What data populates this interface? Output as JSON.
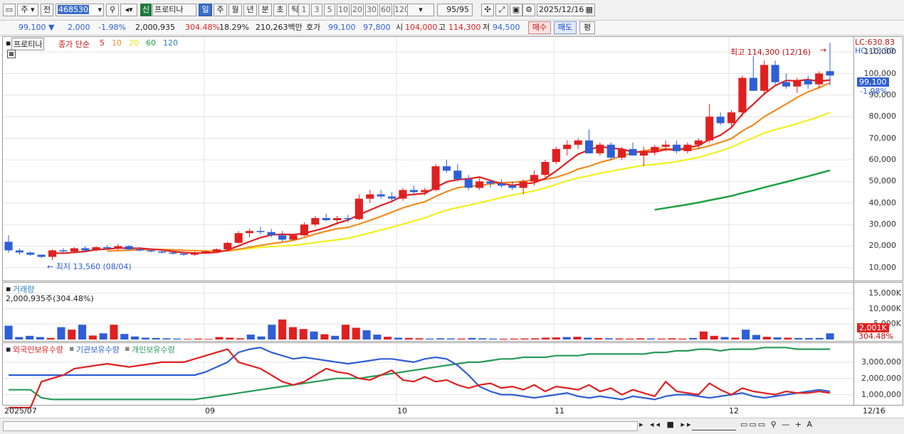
{
  "toolbar": {
    "market": "주",
    "prev": "전",
    "code": "468530",
    "sin": "신",
    "name": "프로티나",
    "periods": [
      "일",
      "주",
      "월",
      "년",
      "분",
      "초",
      "틱"
    ],
    "selected_period": "일",
    "minutes": [
      "1",
      "3",
      "5",
      "10",
      "20",
      "30",
      "60",
      "120"
    ],
    "count": "95",
    "count_total": "/95",
    "date": "2025/12/16"
  },
  "quote": {
    "price": "99,100",
    "arrow": "▼",
    "change": "2,000",
    "change_pct": "-1.98%",
    "volume": "2,000,935",
    "volume_ratio": "304.48%",
    "turnover": "18.29%",
    "amount": "210,263백만",
    "ask_label": "호가",
    "ask": "99,100",
    "bid": "97,800",
    "open_label": "시",
    "open": "104,000",
    "high_label": "고",
    "high": "114,300",
    "low_label": "저",
    "low": "94,500",
    "buy_label": "매수",
    "sell_label": "매도",
    "avg_label": "평"
  },
  "price_panel": {
    "name_tag": "프로티나",
    "ma_title": "종가 단순",
    "ma": [
      {
        "period": "5",
        "color": "#e02020"
      },
      {
        "period": "10",
        "color": "#f08c20"
      },
      {
        "period": "20",
        "color": "#e8e820"
      },
      {
        "period": "60",
        "color": "#20a040"
      },
      {
        "period": "120",
        "color": "#2a80c0"
      }
    ],
    "high_annotation": "최고 114,300 (12/16)",
    "low_annotation": "최저 13,560 (08/04)",
    "lc": "LC:630.83",
    "hc": "HC:-13.30",
    "last_price_tag": "99,100",
    "last_pct_tag": "-1.98%",
    "ticks": [
      "110,000",
      "100,000",
      "90,000",
      "80,000",
      "70,000",
      "60,000",
      "50,000",
      "40,000",
      "30,000",
      "20,000",
      "10,000"
    ]
  },
  "volume_panel": {
    "title": "거래량",
    "info": "2,000,935주(304.48%)",
    "ticks": [
      "15,000K",
      "10,000K",
      "5,000K"
    ],
    "last_tag": "2,001K",
    "last_pct": "304.48%"
  },
  "holding_panel": {
    "series": [
      {
        "name": "외국인보유수량",
        "color": "#e02020"
      },
      {
        "name": "기관보유수량",
        "color": "#2f5fd6"
      },
      {
        "name": "개인보유수량",
        "color": "#2a9a5a"
      }
    ],
    "ticks": [
      "3,000,000",
      "2,000,000",
      "1,000,000"
    ]
  },
  "xaxis": {
    "labels": [
      "2025/07",
      "09",
      "10",
      "11",
      "12"
    ],
    "last": "12/16"
  },
  "chart_data": {
    "type": "candlestick",
    "candles": [
      [
        22000,
        25000,
        17000,
        18000
      ],
      [
        18000,
        19000,
        16000,
        17000
      ],
      [
        17000,
        17500,
        15500,
        16000
      ],
      [
        16000,
        16000,
        14500,
        15000
      ],
      [
        15000,
        18500,
        13560,
        18000
      ],
      [
        18000,
        19000,
        16500,
        17500
      ],
      [
        17500,
        19500,
        17000,
        19000
      ],
      [
        19000,
        20000,
        17500,
        18000
      ],
      [
        18000,
        20000,
        17500,
        19500
      ],
      [
        19500,
        20500,
        18500,
        19000
      ],
      [
        19000,
        21000,
        18000,
        20000
      ],
      [
        20000,
        20500,
        18000,
        18500
      ],
      [
        18500,
        19500,
        17500,
        18000
      ],
      [
        18000,
        18500,
        17000,
        17500
      ],
      [
        17500,
        18000,
        16500,
        17000
      ],
      [
        17000,
        17500,
        16000,
        16500
      ],
      [
        16500,
        17000,
        15500,
        16000
      ],
      [
        16000,
        17500,
        15500,
        17000
      ],
      [
        17000,
        18000,
        16500,
        17500
      ],
      [
        17500,
        19000,
        17000,
        18500
      ],
      [
        18500,
        22000,
        18000,
        21500
      ],
      [
        21500,
        27000,
        21000,
        26000
      ],
      [
        26000,
        28000,
        24000,
        27000
      ],
      [
        27000,
        29000,
        25500,
        26500
      ],
      [
        26500,
        28000,
        24000,
        25000
      ],
      [
        25000,
        27000,
        22000,
        23000
      ],
      [
        23000,
        25500,
        22500,
        25000
      ],
      [
        25000,
        31000,
        24500,
        30000
      ],
      [
        30000,
        34000,
        29000,
        33000
      ],
      [
        33000,
        35000,
        31500,
        32000
      ],
      [
        32000,
        34000,
        30000,
        33000
      ],
      [
        33000,
        34500,
        31000,
        32500
      ],
      [
        32500,
        44000,
        32000,
        42000
      ],
      [
        42000,
        46000,
        40000,
        44000
      ],
      [
        44000,
        46000,
        42000,
        43000
      ],
      [
        43000,
        45000,
        40500,
        42000
      ],
      [
        42000,
        47000,
        41000,
        46000
      ],
      [
        46000,
        48000,
        44500,
        45000
      ],
      [
        45000,
        47000,
        43500,
        46000
      ],
      [
        46000,
        58000,
        45500,
        57000
      ],
      [
        57000,
        60000,
        54000,
        55000
      ],
      [
        55000,
        58000,
        50000,
        51000
      ],
      [
        51000,
        53000,
        46000,
        47000
      ],
      [
        47000,
        52000,
        46000,
        50000
      ],
      [
        50000,
        51000,
        47000,
        49000
      ],
      [
        49000,
        51000,
        47000,
        48000
      ],
      [
        48000,
        50000,
        46000,
        47000
      ],
      [
        47000,
        51000,
        44000,
        50000
      ],
      [
        50000,
        55000,
        48000,
        53000
      ],
      [
        53000,
        60000,
        52000,
        59000
      ],
      [
        59000,
        66000,
        58000,
        65000
      ],
      [
        65000,
        69000,
        62000,
        67000
      ],
      [
        67000,
        70000,
        65000,
        69000
      ],
      [
        69000,
        74000,
        68000,
        63000
      ],
      [
        63000,
        68000,
        62000,
        67000
      ],
      [
        67000,
        68000,
        60000,
        61000
      ],
      [
        61000,
        66000,
        60000,
        65000
      ],
      [
        65000,
        68000,
        63000,
        62000
      ],
      [
        62000,
        66000,
        57000,
        64000
      ],
      [
        64000,
        67000,
        62000,
        66000
      ],
      [
        66000,
        69000,
        64000,
        67000
      ],
      [
        67000,
        69000,
        63000,
        64000
      ],
      [
        64000,
        68000,
        63000,
        67000
      ],
      [
        67000,
        70000,
        65000,
        69000
      ],
      [
        69000,
        86000,
        68000,
        80000
      ],
      [
        80000,
        82000,
        76000,
        77000
      ],
      [
        77000,
        83000,
        75000,
        82000
      ],
      [
        82000,
        99000,
        80000,
        98000
      ],
      [
        98000,
        108000,
        96000,
        92000
      ],
      [
        92000,
        106000,
        90000,
        104000
      ],
      [
        104000,
        106000,
        95000,
        96000
      ],
      [
        96000,
        100000,
        93000,
        94000
      ],
      [
        94000,
        98000,
        91000,
        97000
      ],
      [
        97000,
        99000,
        93000,
        95000
      ],
      [
        95000,
        101000,
        93000,
        100000
      ],
      [
        101100,
        114300,
        94500,
        99100
      ]
    ],
    "ylim": [
      5000,
      115000
    ],
    "volume_k": [
      4500,
      800,
      1200,
      800,
      500,
      4000,
      3200,
      4800,
      1300,
      2000,
      4800,
      1800,
      1000,
      600,
      500,
      400,
      300,
      200,
      300,
      200,
      800,
      600,
      400,
      1600,
      1000,
      4800,
      6500,
      4000,
      3400,
      2600,
      1700,
      1200,
      4800,
      3800,
      3000,
      1600,
      900,
      600,
      500,
      400,
      300,
      400,
      350,
      300,
      500,
      400,
      300,
      250,
      300,
      350,
      400,
      600,
      700,
      800,
      900,
      600,
      500,
      400,
      350,
      300,
      400,
      350,
      300,
      400,
      300,
      500,
      2600,
      1200,
      800,
      600,
      3200,
      1500,
      900,
      700,
      600,
      500,
      450,
      500,
      2001
    ],
    "vol_ylim": [
      0,
      17500
    ],
    "holdings": {
      "foreign": [
        200,
        200,
        200,
        1800,
        2000,
        2200,
        2600,
        2700,
        2800,
        2900,
        2800,
        2700,
        2800,
        2900,
        3000,
        3000,
        3000,
        3200,
        3400,
        3600,
        3800,
        3000,
        2800,
        2600,
        2200,
        1800,
        1600,
        1800,
        2200,
        2600,
        2400,
        2300,
        2000,
        1900,
        2200,
        2500,
        1900,
        1800,
        2100,
        1800,
        1900,
        1600,
        1400,
        1600,
        1700,
        1400,
        1500,
        1300,
        1600,
        1200,
        1500,
        1400,
        1300,
        1600,
        1200,
        1400,
        1000,
        1300,
        1100,
        900,
        1800,
        1200,
        1100,
        1000,
        1700,
        1300,
        1000,
        1400,
        1200,
        1100,
        1000,
        1200,
        1100,
        1100,
        1200,
        1100
      ],
      "institution": [
        2200,
        2200,
        2200,
        2200,
        2200,
        2200,
        2200,
        2200,
        2200,
        2200,
        2200,
        2200,
        2200,
        2200,
        2200,
        2200,
        2200,
        2200,
        2400,
        2700,
        3000,
        3600,
        3800,
        3900,
        3600,
        3400,
        3200,
        3300,
        3200,
        3100,
        3000,
        2900,
        3000,
        3100,
        3200,
        3200,
        3100,
        3000,
        3200,
        3300,
        3200,
        2800,
        2200,
        1500,
        1200,
        1000,
        1000,
        900,
        800,
        900,
        1000,
        1100,
        900,
        800,
        900,
        800,
        700,
        900,
        800,
        700,
        900,
        1000,
        1000,
        900,
        800,
        900,
        1000,
        1100,
        900,
        800,
        900,
        1000,
        1100,
        1200,
        1300,
        1200
      ],
      "individual": [
        1300,
        1300,
        1300,
        800,
        700,
        700,
        700,
        700,
        700,
        700,
        700,
        700,
        700,
        700,
        700,
        700,
        700,
        700,
        800,
        900,
        1000,
        1100,
        1200,
        1300,
        1400,
        1500,
        1600,
        1700,
        1800,
        1900,
        2000,
        2000,
        2000,
        2100,
        2200,
        2300,
        2400,
        2500,
        2600,
        2700,
        2800,
        2900,
        3000,
        3000,
        3100,
        3200,
        3200,
        3300,
        3300,
        3300,
        3400,
        3400,
        3400,
        3500,
        3500,
        3500,
        3500,
        3500,
        3500,
        3600,
        3600,
        3700,
        3700,
        3800,
        3800,
        3700,
        3800,
        3800,
        3800,
        3900,
        3900,
        3900,
        3800,
        3800,
        3800,
        3800
      ]
    },
    "hold_ylim": [
      500,
      4000
    ],
    "x_labels": [
      "2025/07",
      "09",
      "10",
      "11",
      "12"
    ]
  }
}
